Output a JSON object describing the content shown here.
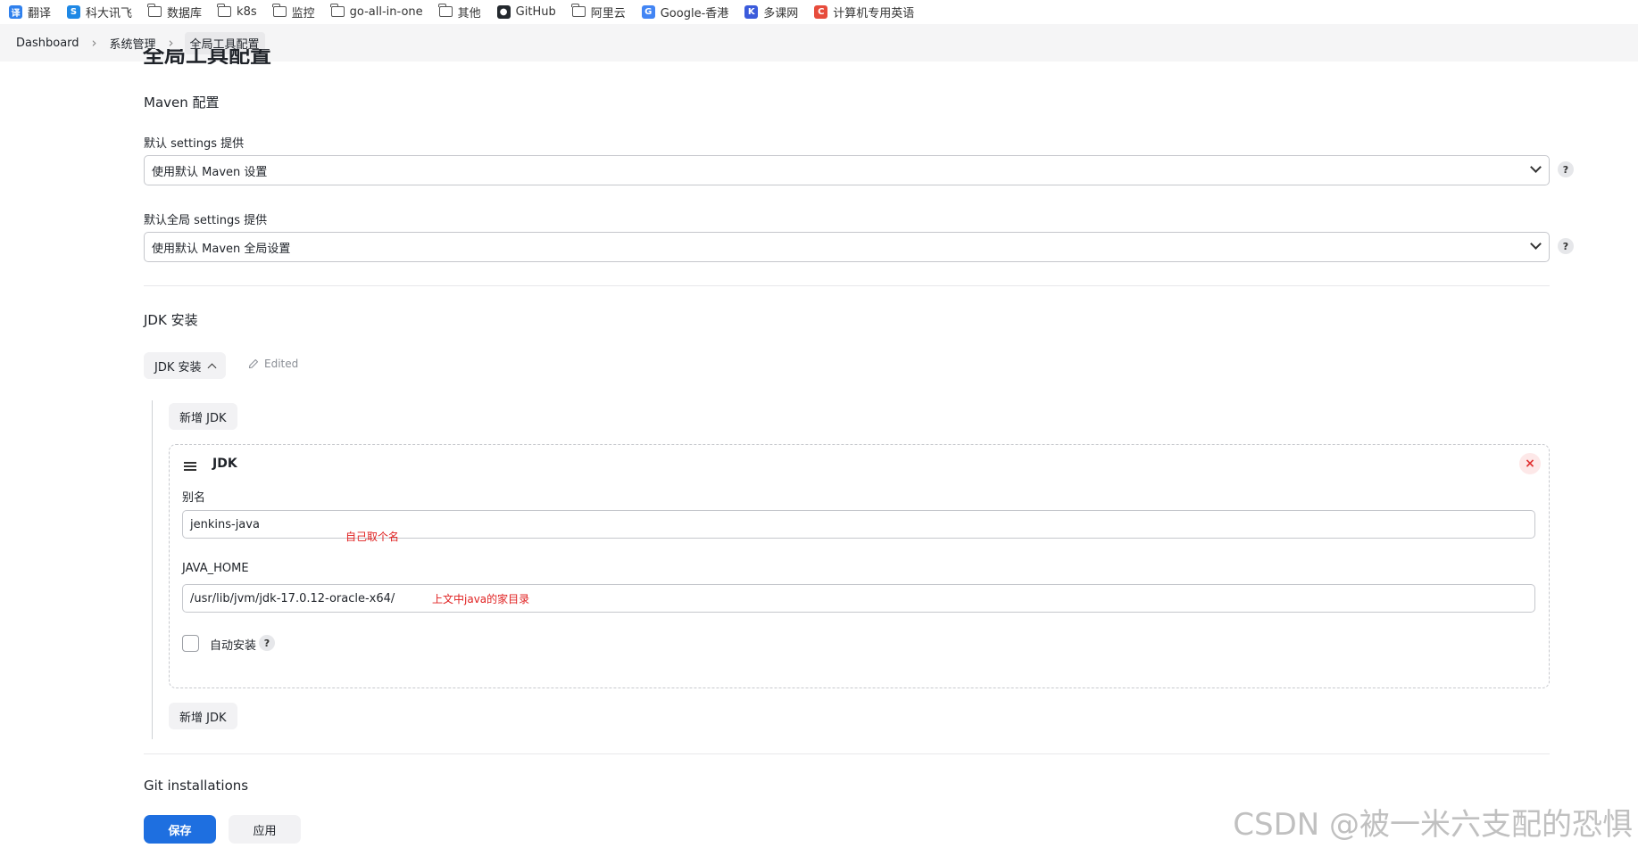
{
  "bookmarks": [
    {
      "label": "翻译",
      "icon": "translate-icon",
      "color": "#2f80ed",
      "glyph": "译"
    },
    {
      "label": "科大讯飞",
      "icon": "iflytek-icon",
      "color": "#1e88e5",
      "glyph": "S"
    },
    {
      "label": "数据库",
      "icon": "folder-icon"
    },
    {
      "label": "k8s",
      "icon": "folder-icon"
    },
    {
      "label": "监控",
      "icon": "folder-icon"
    },
    {
      "label": "go-all-in-one",
      "icon": "folder-icon"
    },
    {
      "label": "其他",
      "icon": "folder-icon"
    },
    {
      "label": "GitHub",
      "icon": "github-icon",
      "color": "#24292e",
      "glyph": "●"
    },
    {
      "label": "阿里云",
      "icon": "folder-icon"
    },
    {
      "label": "Google-香港",
      "icon": "google-icon",
      "color": "#4285f4",
      "glyph": "G"
    },
    {
      "label": "多课网",
      "icon": "duoke-icon",
      "color": "#3b5bdb",
      "glyph": "K"
    },
    {
      "label": "计算机专用英语",
      "icon": "csdn-icon",
      "color": "#e74c3c",
      "glyph": "C"
    }
  ],
  "breadcrumb": {
    "items": [
      "Dashboard",
      "系统管理",
      "全局工具配置"
    ],
    "separator": "›"
  },
  "page_title": "全局工具配置",
  "maven": {
    "heading": "Maven 配置",
    "settings_label": "默认 settings 提供",
    "settings_value": "使用默认 Maven 设置",
    "global_settings_label": "默认全局 settings 提供",
    "global_settings_value": "使用默认 Maven 全局设置",
    "help": "?"
  },
  "jdk": {
    "heading": "JDK 安装",
    "toggle_label": "JDK 安装",
    "edited_label": "Edited",
    "add_button": "新增 JDK",
    "card": {
      "title": "JDK",
      "close_glyph": "×",
      "alias_label": "别名",
      "alias_value": "jenkins-java",
      "alias_note": "自己取个名",
      "home_label": "JAVA_HOME",
      "home_value": "/usr/lib/jvm/jdk-17.0.12-oracle-x64/",
      "home_note": "上文中java的家目录",
      "auto_install_label": "自动安装",
      "help": "?"
    }
  },
  "git": {
    "heading": "Git installations"
  },
  "footer": {
    "save": "保存",
    "apply": "应用"
  },
  "watermark": "CSDN @被一米六支配的恐惧"
}
